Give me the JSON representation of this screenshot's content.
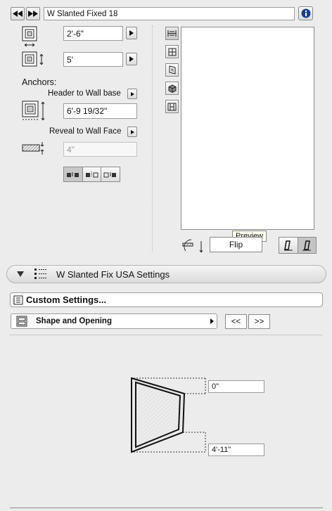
{
  "header": {
    "object_name": "W Slanted Fixed 18"
  },
  "dimensions": {
    "width_value": "2'-6\"",
    "height_value": "5'"
  },
  "anchors": {
    "title": "Anchors:",
    "header_label": "Header to Wall base",
    "header_value": "6'-9 19/32\"",
    "reveal_label": "Reveal to Wall Face",
    "reveal_value": "4\""
  },
  "preview": {
    "tooltip": "Preview",
    "flip_label": "Flip"
  },
  "panel": {
    "title": "W Slanted Fix USA Settings"
  },
  "settings": {
    "custom_label": "Custom Settings...",
    "page_label": "Shape and Opening",
    "prev_label": "<<",
    "next_label": ">>"
  },
  "shape": {
    "top_value": "0\"",
    "bottom_value": "4'-11\""
  }
}
